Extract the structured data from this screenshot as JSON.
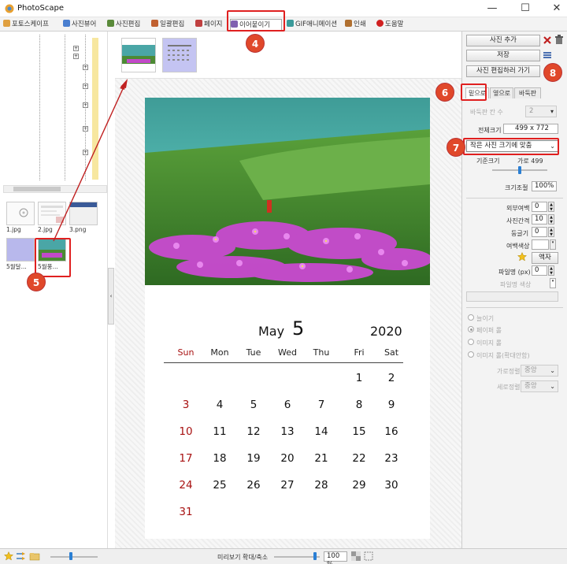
{
  "window": {
    "title": "PhotoScape",
    "minimize": "—",
    "maximize": "☐",
    "close": "✕"
  },
  "tabs": [
    {
      "label": "포토스케이프",
      "color": "#e0a040"
    },
    {
      "label": "사진뷰어",
      "color": "#4a7fd0"
    },
    {
      "label": "사진편집",
      "color": "#5a8a3a"
    },
    {
      "label": "일괄편집",
      "color": "#c06030"
    },
    {
      "label": "페이지",
      "color": "#c04040"
    },
    {
      "label": "이어붙이기",
      "color": "#8060b0"
    },
    {
      "label": "GIF애니메이션",
      "color": "#3a9a9a"
    },
    {
      "label": "인쇄",
      "color": "#b07030"
    },
    {
      "label": "도움말",
      "color": "#d02020"
    }
  ],
  "files": [
    {
      "caption": "1.jpg"
    },
    {
      "caption": "2.jpg"
    },
    {
      "caption": "3.png"
    },
    {
      "caption": "5월달..."
    },
    {
      "caption": "5월풍..."
    }
  ],
  "calendar": {
    "month": "May",
    "month_num": "5",
    "year": "2020",
    "weekdays": [
      "Sun",
      "Mon",
      "Tue",
      "Wed",
      "Thu",
      "Fri",
      "Sat"
    ],
    "weeks": [
      [
        "",
        "",
        "",
        "",
        "",
        "1",
        "2"
      ],
      [
        "3",
        "4",
        "5",
        "6",
        "7",
        "8",
        "9"
      ],
      [
        "10",
        "11",
        "12",
        "13",
        "14",
        "15",
        "16"
      ],
      [
        "17",
        "18",
        "19",
        "20",
        "21",
        "22",
        "23"
      ],
      [
        "24",
        "25",
        "26",
        "27",
        "28",
        "29",
        "30"
      ],
      [
        "31",
        "",
        "",
        "",
        "",
        "",
        ""
      ]
    ]
  },
  "right": {
    "add_photo": "사진 추가",
    "save": "저장",
    "go_edit": "사진 편집하러 가기",
    "tab_down": "밑으로",
    "tab_side": "옆으로",
    "tab_grid": "바둑판",
    "grid_cols_label": "바둑판 칸 수",
    "grid_cols_value": "2",
    "total_size_label": "전체크기",
    "total_size_value": "499 x 772",
    "fit_option": "작은 사진 크기에 맞춤",
    "base_size_label": "기준크기",
    "base_size_value": "가로 499",
    "scale_label": "크기조절",
    "scale_value": "100%",
    "outer_margin_label": "외부여백",
    "outer_margin_value": "0",
    "photo_gap_label": "사진간격",
    "photo_gap_value": "10",
    "round_label": "둥글기",
    "round_value": "0",
    "margin_color_label": "여백색상",
    "frame_button": "액자",
    "border_label": "파일명 (px)",
    "border_value": "0",
    "border_color_label": "파일명 색상",
    "opt_stretch": "늘이기",
    "opt_paper": "페이퍼 롤",
    "opt_image": "이미지 롤",
    "opt_image_zoom": "이미지 롤(확대안함)",
    "h_align_label": "가로정렬",
    "h_align_value": "중앙",
    "v_align_label": "세로정렬",
    "v_align_value": "중앙"
  },
  "status": {
    "preview_label": "미리보기 확대/축소",
    "zoom_value": "100 %"
  },
  "annotations": [
    "4",
    "5",
    "6",
    "7",
    "8"
  ],
  "colors": {
    "annotation": "#e02020",
    "badge": "#e0482a",
    "sunday": "#a81212"
  }
}
